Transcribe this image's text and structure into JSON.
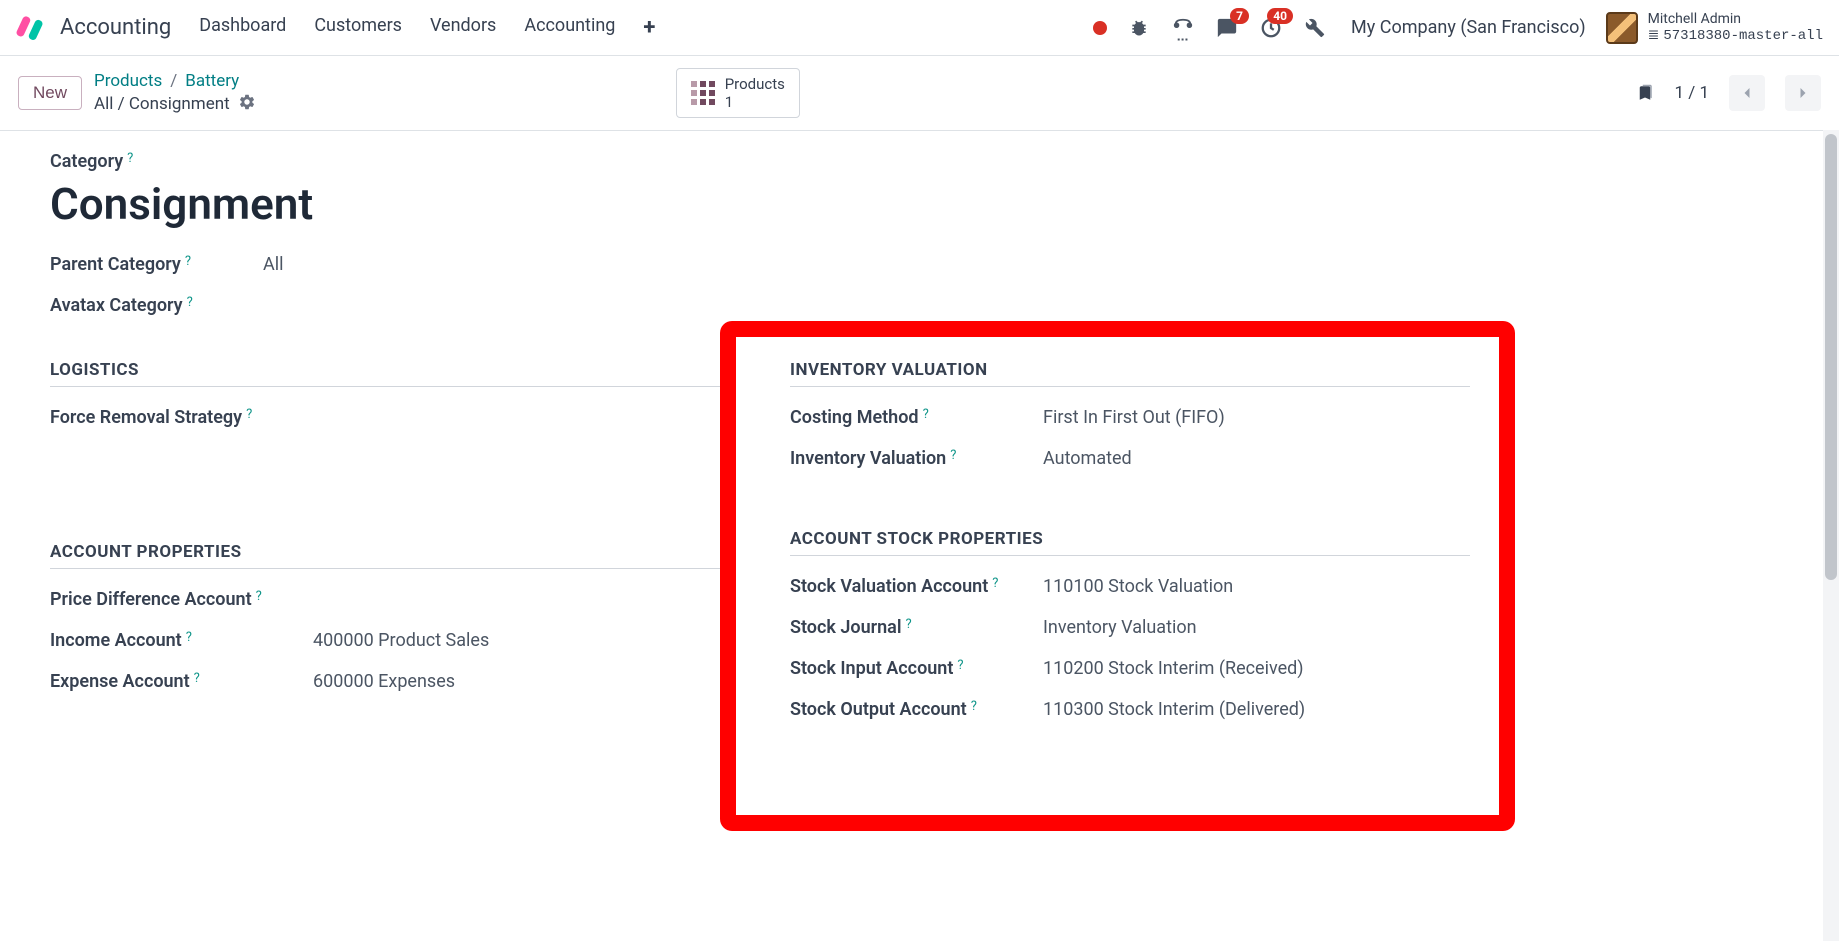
{
  "navbar": {
    "brand": "Accounting",
    "menu": [
      "Dashboard",
      "Customers",
      "Vendors",
      "Accounting"
    ],
    "messages_badge": "7",
    "activities_badge": "40",
    "company": "My Company (San Francisco)",
    "user_name": "Mitchell Admin",
    "db_name": "57318380-master-all"
  },
  "controls": {
    "new_label": "New",
    "breadcrumb_products": "Products",
    "breadcrumb_battery": "Battery",
    "breadcrumb_sub": "All / Consignment",
    "stat_label": "Products",
    "stat_count": "1",
    "pager": "1 / 1"
  },
  "form": {
    "category_label": "Category",
    "title": "Consignment",
    "parent_category_label": "Parent Category",
    "parent_category_value": "All",
    "avatax_label": "Avatax Category",
    "sections": {
      "logistics": {
        "title": "Logistics",
        "force_removal_label": "Force Removal Strategy"
      },
      "account_properties": {
        "title": "Account Properties",
        "price_diff_label": "Price Difference Account",
        "income_label": "Income Account",
        "income_value": "400000 Product Sales",
        "expense_label": "Expense Account",
        "expense_value": "600000 Expenses"
      },
      "inventory_valuation": {
        "title": "Inventory Valuation",
        "costing_label": "Costing Method",
        "costing_value": "First In First Out (FIFO)",
        "valuation_label": "Inventory Valuation",
        "valuation_value": "Automated"
      },
      "account_stock": {
        "title": "Account Stock Properties",
        "stock_val_label": "Stock Valuation Account",
        "stock_val_value": "110100 Stock Valuation",
        "journal_label": "Stock Journal",
        "journal_value": "Inventory Valuation",
        "input_label": "Stock Input Account",
        "input_value": "110200 Stock Interim (Received)",
        "output_label": "Stock Output Account",
        "output_value": "110300 Stock Interim (Delivered)"
      }
    }
  }
}
